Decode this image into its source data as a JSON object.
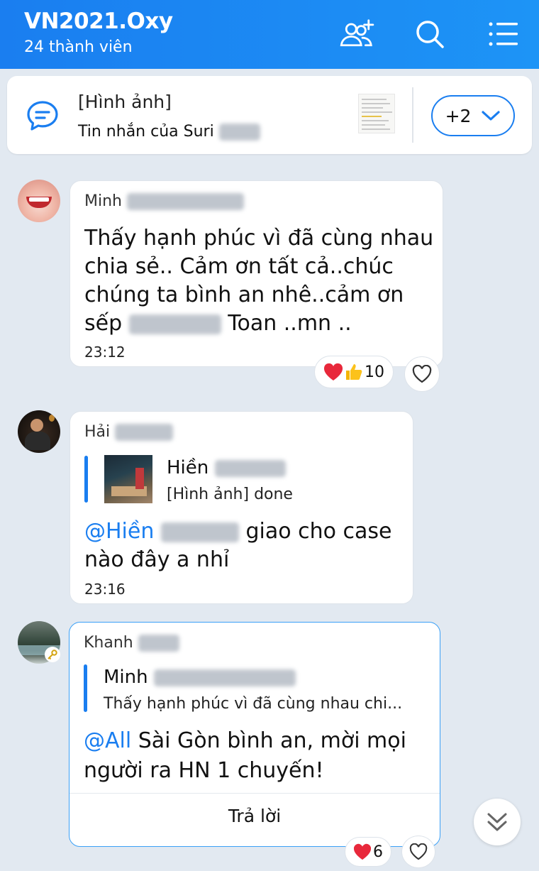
{
  "header": {
    "title": "VN2021.Oxy",
    "subtitle": "24 thành viên",
    "colors": {
      "bar": "#1a7ef0"
    }
  },
  "pinned": {
    "title": "[Hình ảnh]",
    "subtitle": "Tin nhắn của Suri",
    "more_label": "+2"
  },
  "messages": [
    {
      "sender": "Minh",
      "lines": [
        "Thấy hạnh phúc vì đã cùng nhau",
        "chia sẻ.. Cảm ơn tất cả..chúc",
        "chúng ta bình an nhê..cảm ơn"
      ],
      "line4_prefix": "sếp",
      "line4_suffix": "Toan ..mn ..",
      "time": "23:12",
      "reaction_count": "10"
    },
    {
      "sender": "Hải",
      "quote_name": "Hiền",
      "quote_text": "[Hình ảnh] done",
      "mention": "@Hiền",
      "line1_suffix": "giao cho case",
      "line2": "nào đây a nhỉ",
      "time": "23:16"
    },
    {
      "sender": "Khanh",
      "quote_name": "Minh",
      "quote_text": "Thấy hạnh phúc vì đã cùng nhau chi...",
      "mention": "@All",
      "line1_suffix": "Sài Gòn bình an, mời mọi",
      "line2": "người ra HN 1 chuyến!",
      "reply_label": "Trả lời",
      "reaction_count": "6"
    }
  ],
  "icons": [
    "add-member-icon",
    "search-icon",
    "menu-icon",
    "chat-bubble-icon",
    "chevron-down-icon",
    "heart-icon",
    "thumbs-up-icon",
    "double-chevron-down-icon"
  ]
}
